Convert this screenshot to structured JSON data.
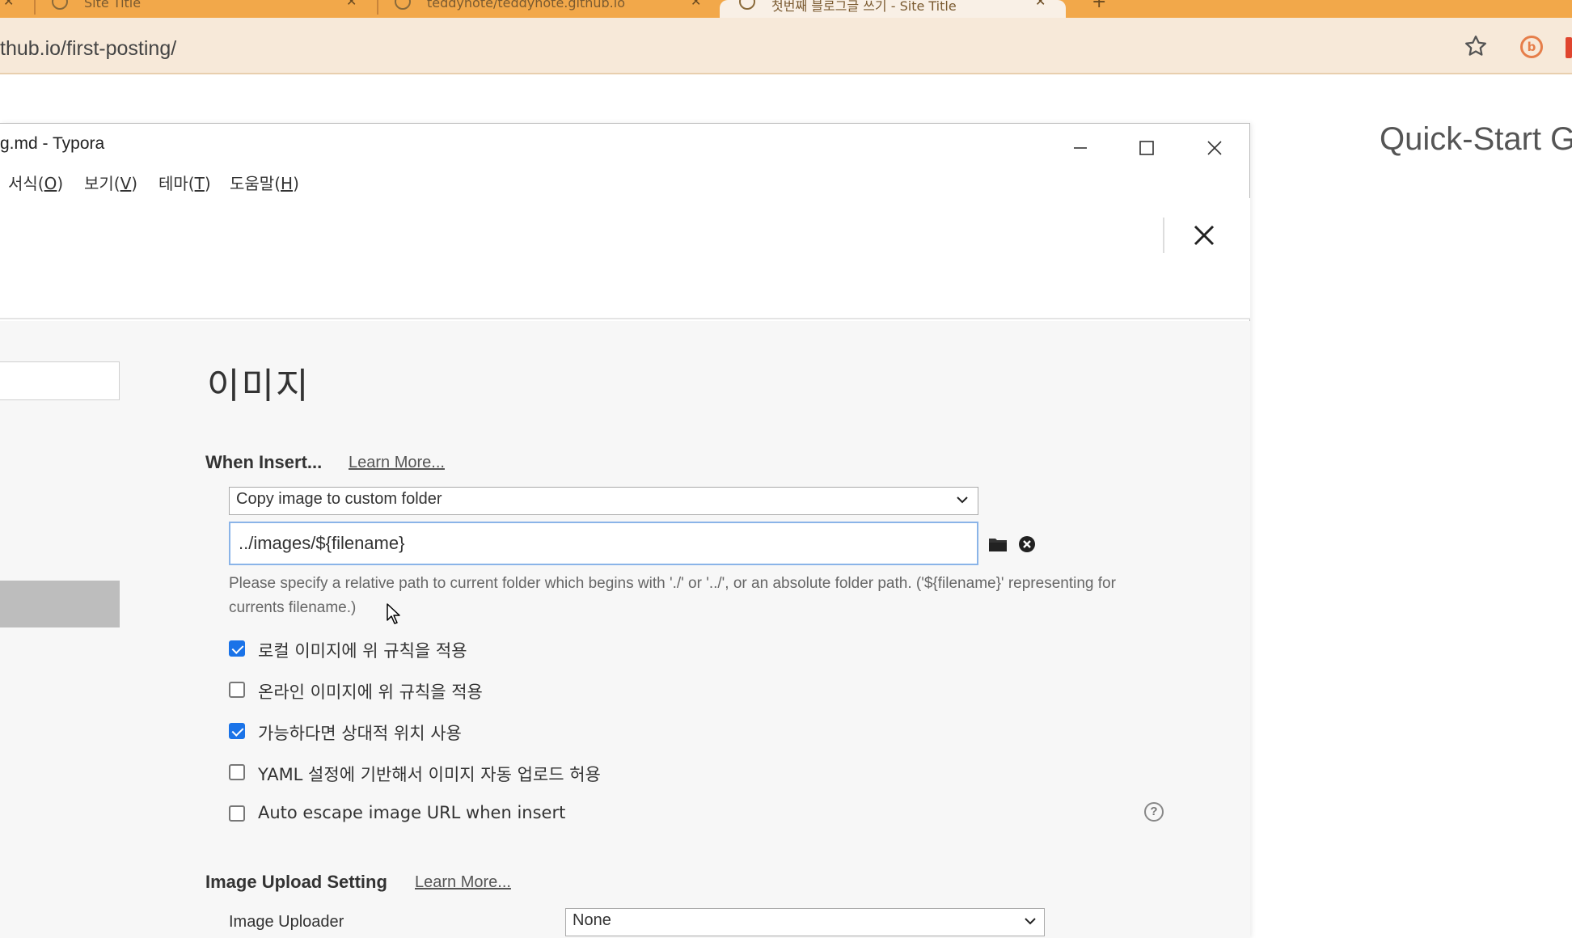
{
  "browser": {
    "tabs": [
      {
        "title": "Site Title"
      },
      {
        "title": "teddynote/teddynote.github.io"
      },
      {
        "title": "첫번째 블로그글 쓰기 - Site Title"
      }
    ],
    "new_tab_label": "+",
    "url": "thub.io/first-posting/"
  },
  "background_page": {
    "heading": "Quick-Start Gu"
  },
  "window": {
    "title": "g.md - Typora",
    "controls": {
      "minimize": "minimize-icon",
      "maximize": "maximize-icon",
      "close": "close-icon"
    }
  },
  "menubar": {
    "items": [
      {
        "label": "서식(",
        "key": "O",
        "end": ")"
      },
      {
        "label": "보기(",
        "key": "V",
        "end": ")"
      },
      {
        "label": "테마(",
        "key": "T",
        "end": ")"
      },
      {
        "label": "도움말(",
        "key": "H",
        "end": ")"
      }
    ]
  },
  "preferences": {
    "section_title": "이미지",
    "when_insert": {
      "label": "When Insert...",
      "learn_more": "Learn More...",
      "action_select": "Copy image to custom folder",
      "path_value": "../images/${filename}",
      "hint": "Please specify a relative path to current folder which begins with './' or '../', or an absolute folder path. ('${filename}' representing for currents filename.)"
    },
    "checkboxes": [
      {
        "label": "로컬 이미지에 위 규칙을 적용",
        "checked": true
      },
      {
        "label": "온라인 이미지에 위 규칙을 적용",
        "checked": false
      },
      {
        "label": "가능하다면 상대적 위치 사용",
        "checked": true
      },
      {
        "label": "YAML 설정에 기반해서 이미지 자동 업로드 허용",
        "checked": false
      },
      {
        "label": "Auto escape image URL when insert",
        "checked": false
      }
    ],
    "help_glyph": "?",
    "upload": {
      "label": "Image Upload Setting",
      "learn_more": "Learn More...",
      "uploader_label": "Image Uploader",
      "uploader_value": "None"
    }
  },
  "colors": {
    "tabbar": "#f2a84a",
    "checkbox_on": "#1a73e8",
    "input_focus": "#8ab4e8"
  }
}
